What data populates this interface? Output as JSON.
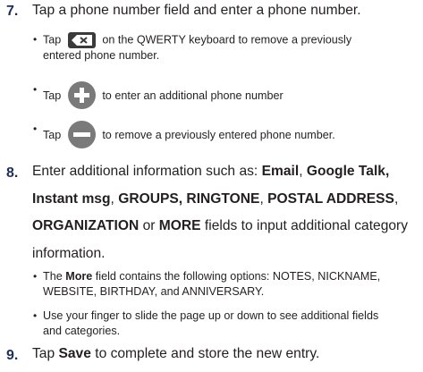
{
  "step7": {
    "number": "7.",
    "text": "Tap a phone number field and enter a phone number.",
    "bullets": [
      {
        "pre": "Tap",
        "icon": "backspace-icon",
        "post": "on the QWERTY keyboard to remove a previously",
        "line2": "entered phone number."
      },
      {
        "pre": "Tap",
        "icon": "add-circle-icon",
        "post": "to enter an additional phone number"
      },
      {
        "pre": "Tap",
        "icon": "remove-circle-icon",
        "post": "to remove a previously entered phone number."
      }
    ]
  },
  "step8": {
    "number": "8.",
    "line1_pre": "Enter additional information such as: ",
    "email": "Email",
    "sep1": ", ",
    "google_talk": "Google Talk,",
    "instant_msg": "Instant msg",
    "sep2": ", ",
    "groups": "GROUPS, RINGTONE",
    "sep3": ", ",
    "postal": "POSTAL ADDRESS",
    "sep4": ",",
    "organization": "ORGANIZATION",
    "or": " or ",
    "more": "MORE",
    "line3_post": " fields to input additional category",
    "line4": "information.",
    "bullet1_pre": "The ",
    "bullet1_more": "More",
    "bullet1_post": " field contains the following options: NOTES, NICKNAME,",
    "bullet1_line2": "WEBSITE, BIRTHDAY, and ANNIVERSARY.",
    "bullet2_line1": "Use your finger to slide the page up or down to see additional fields",
    "bullet2_line2": "and categories."
  },
  "step9": {
    "number": "9.",
    "pre": "Tap ",
    "save": "Save",
    "post": " to complete and store the new entry."
  },
  "colors": {
    "number": "#1b2f5c",
    "text": "#231f20",
    "icon": "#7a7a7a"
  }
}
